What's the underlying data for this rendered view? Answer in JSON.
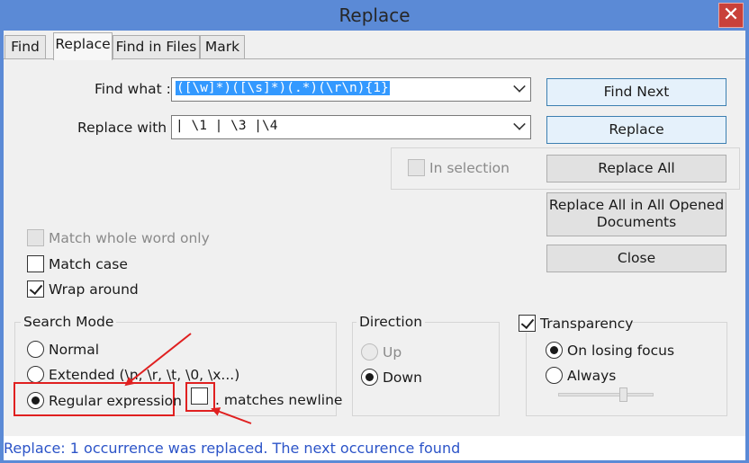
{
  "window": {
    "title": "Replace",
    "close_glyph": "✕"
  },
  "tabs": [
    {
      "label": "Find"
    },
    {
      "label": "Replace"
    },
    {
      "label": "Find in Files"
    },
    {
      "label": "Mark"
    }
  ],
  "find_what": {
    "label": "Find what :",
    "value": "([\\w]*)([\\s]*)(.*)(\\r\\n){1}"
  },
  "replace_with": {
    "label": "Replace with :",
    "value": "| \\1 | \\3 |\\4"
  },
  "in_selection": {
    "label": "In selection",
    "checked": false,
    "enabled": false
  },
  "buttons": {
    "find_next": "Find Next",
    "replace": "Replace",
    "replace_all": "Replace All",
    "replace_all_opened_line1": "Replace All in All Opened",
    "replace_all_opened_line2": "Documents",
    "close": "Close"
  },
  "options": {
    "match_whole_word": {
      "label": "Match whole word only",
      "checked": false,
      "enabled": false
    },
    "match_case": {
      "label": "Match case",
      "checked": false
    },
    "wrap_around": {
      "label": "Wrap around",
      "checked": true
    }
  },
  "search_mode": {
    "title": "Search Mode",
    "normal": "Normal",
    "extended": "Extended (\\n, \\r, \\t, \\0, \\x...)",
    "regex": "Regular expression",
    "selected": "regex",
    "matches_newline": {
      "label": ". matches newline",
      "checked": false
    }
  },
  "direction": {
    "title": "Direction",
    "up": {
      "label": "Up",
      "enabled": false
    },
    "down": {
      "label": "Down",
      "selected": true
    }
  },
  "transparency": {
    "title": "Transparency",
    "checked": true,
    "on_losing_focus": "On losing focus",
    "always": "Always",
    "selected": "on_losing_focus",
    "slider_level": 0.7
  },
  "status": {
    "text": "Replace: 1 occurrence was replaced. The next occurence found"
  },
  "colors": {
    "title_bar": "#5b8ad6",
    "close": "#c9413a",
    "annotation": "#e02020",
    "status_text": "#2c54c8"
  }
}
